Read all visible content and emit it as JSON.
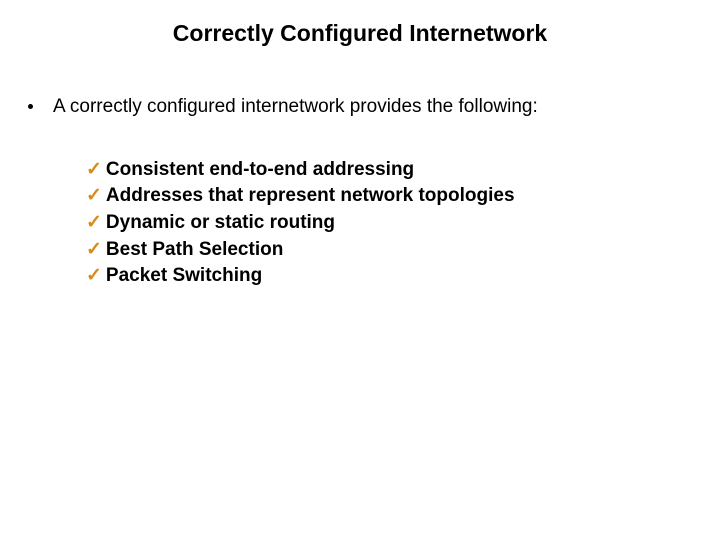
{
  "title": "Correctly Configured Internetwork",
  "lead": "A correctly configured internetwork provides the following:",
  "items": [
    "Consistent end-to-end addressing",
    "Addresses that represent network topologies",
    "Dynamic or static routing",
    "Best Path Selection",
    "Packet Switching"
  ],
  "check_glyph": "✓"
}
